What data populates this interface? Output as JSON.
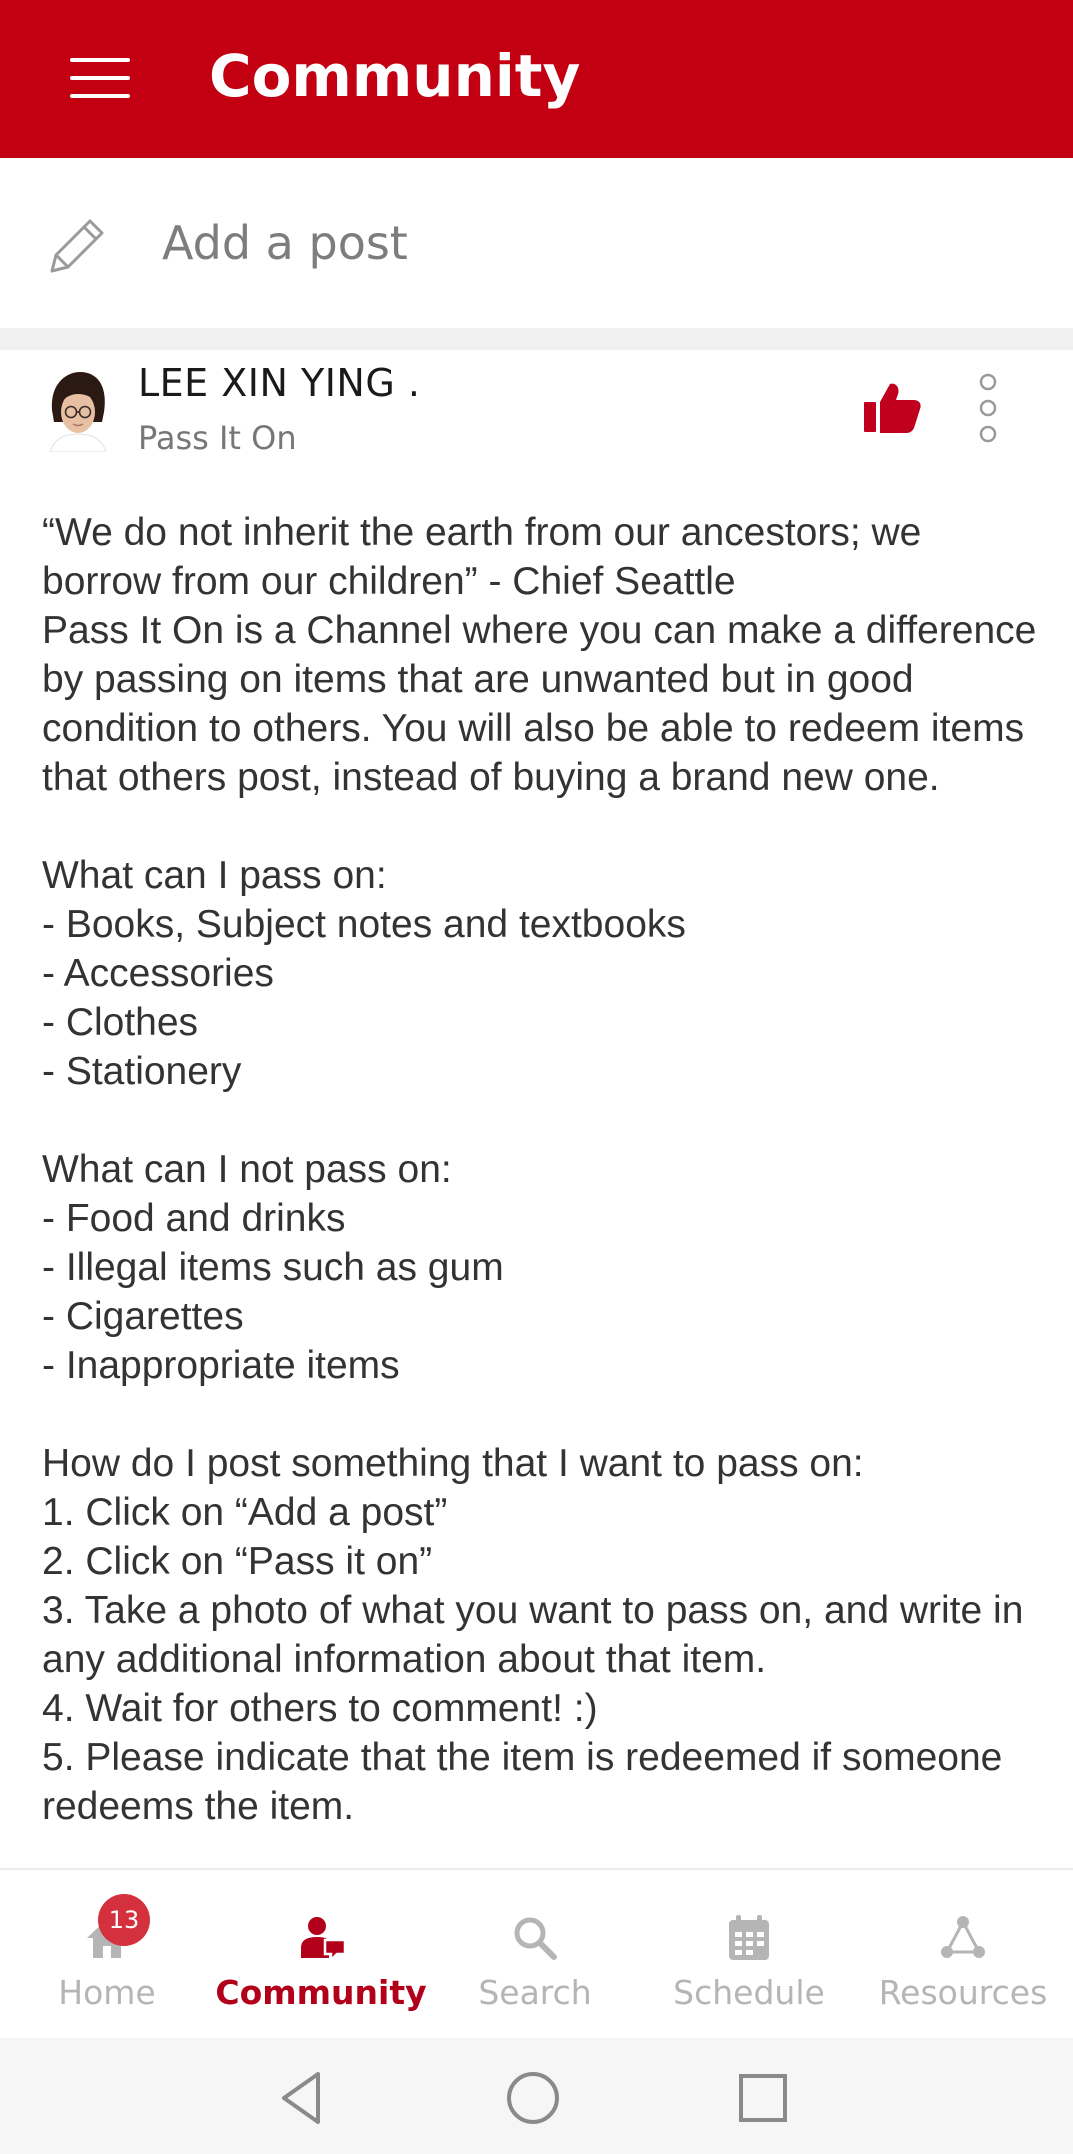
{
  "header": {
    "title": "Community",
    "menu_icon": "hamburger-menu-icon",
    "background_color": "#c20012"
  },
  "composer": {
    "icon": "pencil-icon",
    "placeholder": "Add a post"
  },
  "post": {
    "author": "LEE XIN YING .",
    "channel": "Pass It On",
    "like_icon": "thumbs-up-icon",
    "liked": true,
    "menu_icon": "more-vertical-icon",
    "body": "“We do not inherit the earth from our ancestors; we borrow from our children” - Chief Seattle\nPass It On is a Channel where you can make a difference by passing on items that are unwanted but in good condition to others. You will also be able to redeem items that others post, instead of buying a brand new one.\n\nWhat can I pass on:\n- Books, Subject notes and textbooks\n- Accessories\n- Clothes\n- Stationery\n\nWhat can I not pass on:\n- Food and drinks\n- Illegal items such as gum\n- Cigarettes\n- Inappropriate items\n\nHow do I post something that I want to pass on:\n1. Click on “Add a post”\n2. Click on “Pass it on”\n3. Take a photo of what you want to pass on, and write in any additional information about that item.\n4. Wait for others to comment! :)\n5. Please indicate that the item is redeemed if someone redeems the item."
  },
  "bottom_nav": {
    "items": [
      {
        "label": "Home",
        "icon": "home-icon",
        "badge": "13",
        "active": false
      },
      {
        "label": "Community",
        "icon": "community-icon",
        "active": true
      },
      {
        "label": "Search",
        "icon": "search-icon",
        "active": false
      },
      {
        "label": "Schedule",
        "icon": "calendar-icon",
        "active": false
      },
      {
        "label": "Resources",
        "icon": "resources-network-icon",
        "active": false
      }
    ],
    "active_color": "#b3001a",
    "inactive_color": "#b5b5b5"
  },
  "system_nav": {
    "buttons": [
      "back-icon",
      "home-circle-icon",
      "recents-square-icon"
    ]
  }
}
